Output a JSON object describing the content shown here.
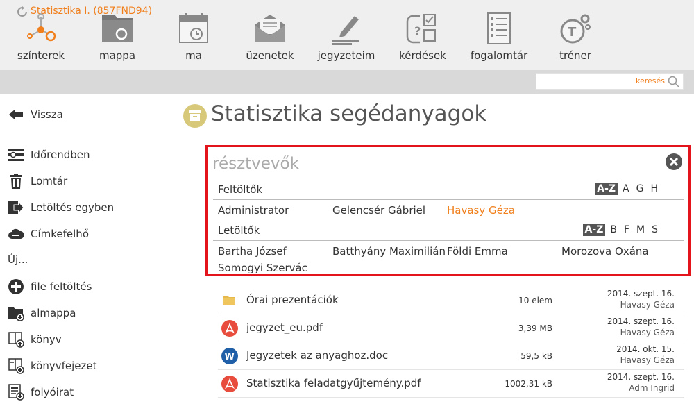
{
  "nav": {
    "items": [
      {
        "label": "színterek",
        "icon": "network-icon"
      },
      {
        "label": "mappa",
        "icon": "folder-icon"
      },
      {
        "label": "ma",
        "icon": "calendar-icon"
      },
      {
        "label": "üzenetek",
        "icon": "envelope-icon"
      },
      {
        "label": "jegyzeteim",
        "icon": "pencil-icon"
      },
      {
        "label": "kérdések",
        "icon": "questions-icon"
      },
      {
        "label": "fogalomtár",
        "icon": "glossary-icon"
      },
      {
        "label": "tréner",
        "icon": "trainer-icon"
      }
    ]
  },
  "breadcrumb": {
    "label": "Statisztika I. (857FND94)"
  },
  "search": {
    "placeholder": "keresés"
  },
  "sidebar": {
    "back": "Vissza",
    "items": [
      {
        "label": "Időrendben"
      },
      {
        "label": "Lomtár"
      },
      {
        "label": "Letöltés egyben"
      },
      {
        "label": "Címkefelhő"
      }
    ],
    "new_label": "Új...",
    "new_items": [
      {
        "label": "file feltöltés"
      },
      {
        "label": "almappa"
      },
      {
        "label": "könyv"
      },
      {
        "label": "könyvfejezet"
      },
      {
        "label": "folyóirat"
      }
    ]
  },
  "page": {
    "title": "Statisztika segédanyagok"
  },
  "participants": {
    "title": "résztvevők",
    "uploaders": {
      "label": "Feltöltők",
      "sort": [
        "A-Z",
        "A",
        "G",
        "H"
      ],
      "people": [
        "Administrator",
        "Gelencsér Gábriel",
        "Havasy Géza"
      ]
    },
    "downloaders": {
      "label": "Letöltők",
      "sort": [
        "A-Z",
        "B",
        "F",
        "M",
        "S"
      ],
      "people": [
        "Bartha József",
        "Batthyány Maximilián",
        "Földi Emma",
        "Morozova Oxána",
        "Somogyi Szervác"
      ]
    }
  },
  "files": [
    {
      "name": "Órai prezentációk",
      "size": "10 elem",
      "date": "2014. szept. 16.",
      "user": "Havasy Géza",
      "type": "folder"
    },
    {
      "name": "jegyzet_eu.pdf",
      "size": "3,39 MB",
      "date": "2014. szept. 16.",
      "user": "Havasy Géza",
      "type": "pdf"
    },
    {
      "name": "Jegyzetek az anyaghoz.doc",
      "size": "59,5 kB",
      "date": "2014. okt. 15.",
      "user": "Havasy Géza",
      "type": "word"
    },
    {
      "name": "Statisztika feladatgyűjtemény.pdf",
      "size": "1002,31 kB",
      "date": "2014. szept. 16.",
      "user": "Adm Ingrid",
      "type": "pdf"
    }
  ],
  "colors": {
    "accent": "#f07f1c",
    "highlight_border": "#e3141b",
    "pdf": "#e74c3c",
    "word": "#1f5fa8",
    "folder": "#e7b84a"
  }
}
